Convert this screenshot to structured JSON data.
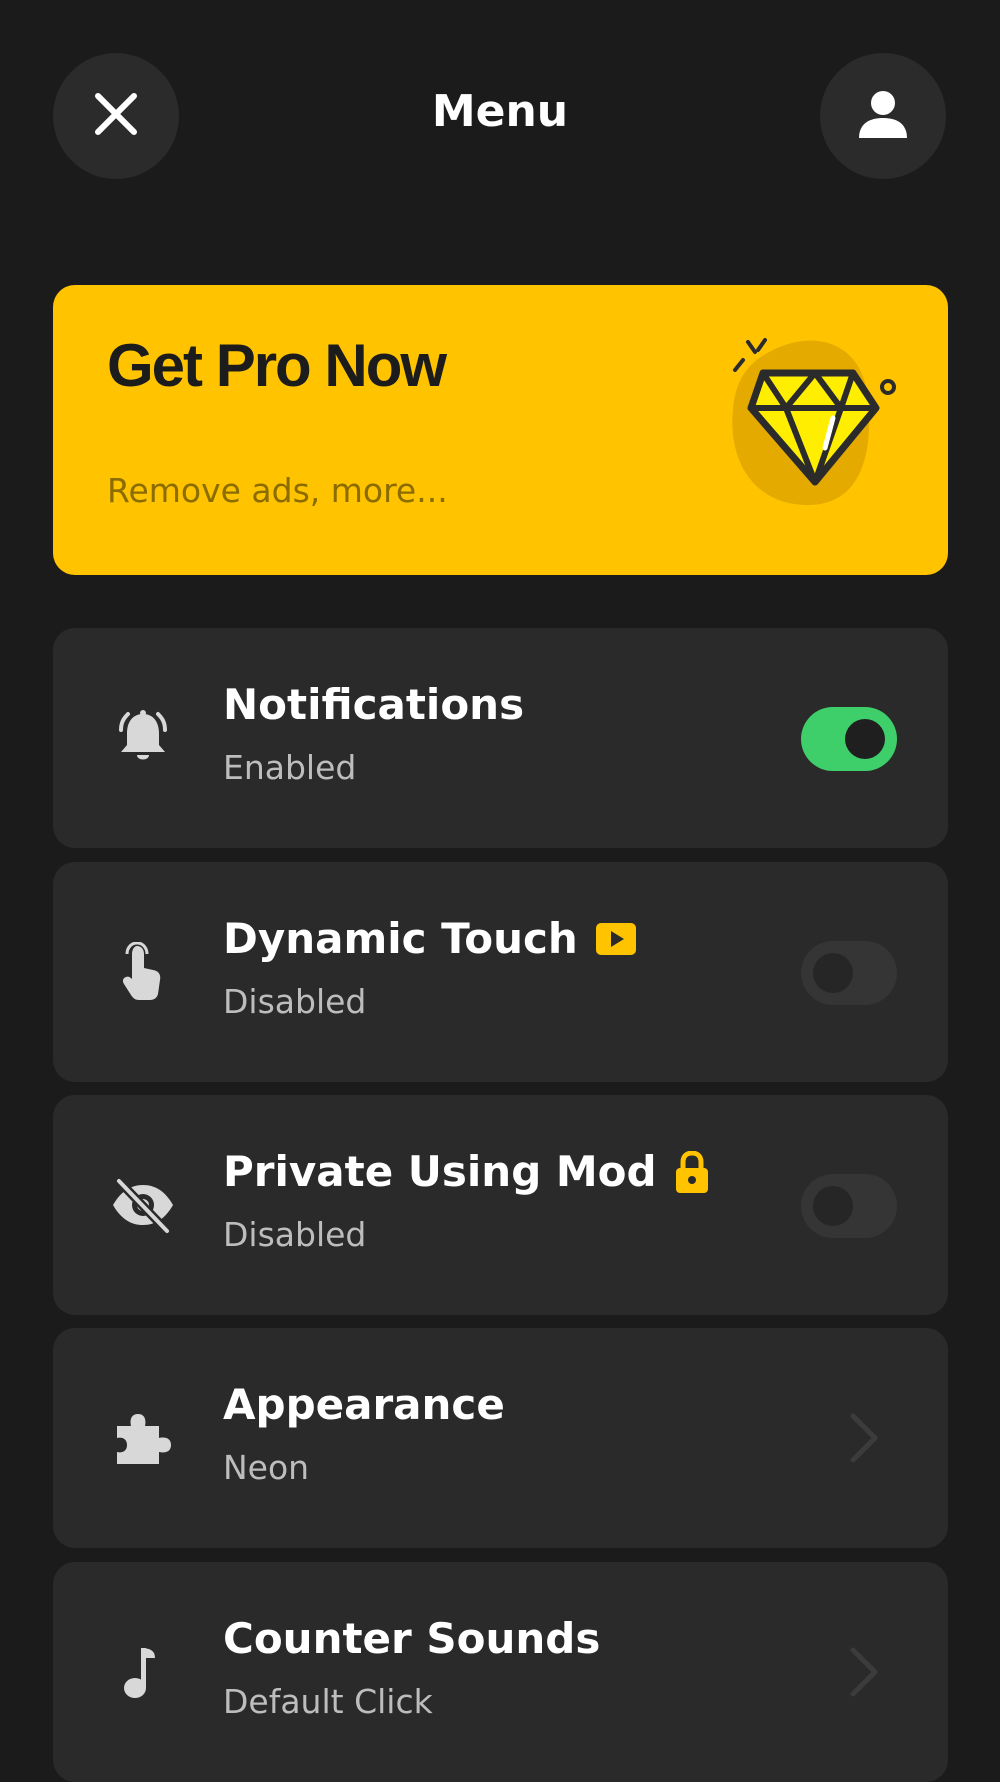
{
  "header": {
    "title": "Menu",
    "close_icon": "close-icon",
    "profile_icon": "user-icon"
  },
  "promo": {
    "title": "Get Pro Now",
    "subtitle": "Remove ads, more...",
    "icon": "diamond-icon",
    "bg_color": "#ffc300"
  },
  "settings": [
    {
      "title": "Notifications",
      "subtitle": "Enabled",
      "icon": "bell-icon",
      "control": "toggle",
      "on": true
    },
    {
      "title": "Dynamic Touch",
      "subtitle": "Disabled",
      "icon": "touch-icon",
      "badge": "video-icon",
      "control": "toggle",
      "on": false
    },
    {
      "title": "Private Using Mod",
      "subtitle": "Disabled",
      "icon": "eye-off-icon",
      "badge": "lock-icon",
      "control": "toggle",
      "on": false
    },
    {
      "title": "Appearance",
      "subtitle": "Neon",
      "icon": "puzzle-icon",
      "control": "chevron"
    },
    {
      "title": "Counter Sounds",
      "subtitle": "Default Click",
      "icon": "music-note-icon",
      "control": "chevron"
    }
  ],
  "colors": {
    "background": "#1b1b1b",
    "card": "#2a2a2a",
    "accent": "#ffc300",
    "toggle_on": "#3ecf6b"
  }
}
